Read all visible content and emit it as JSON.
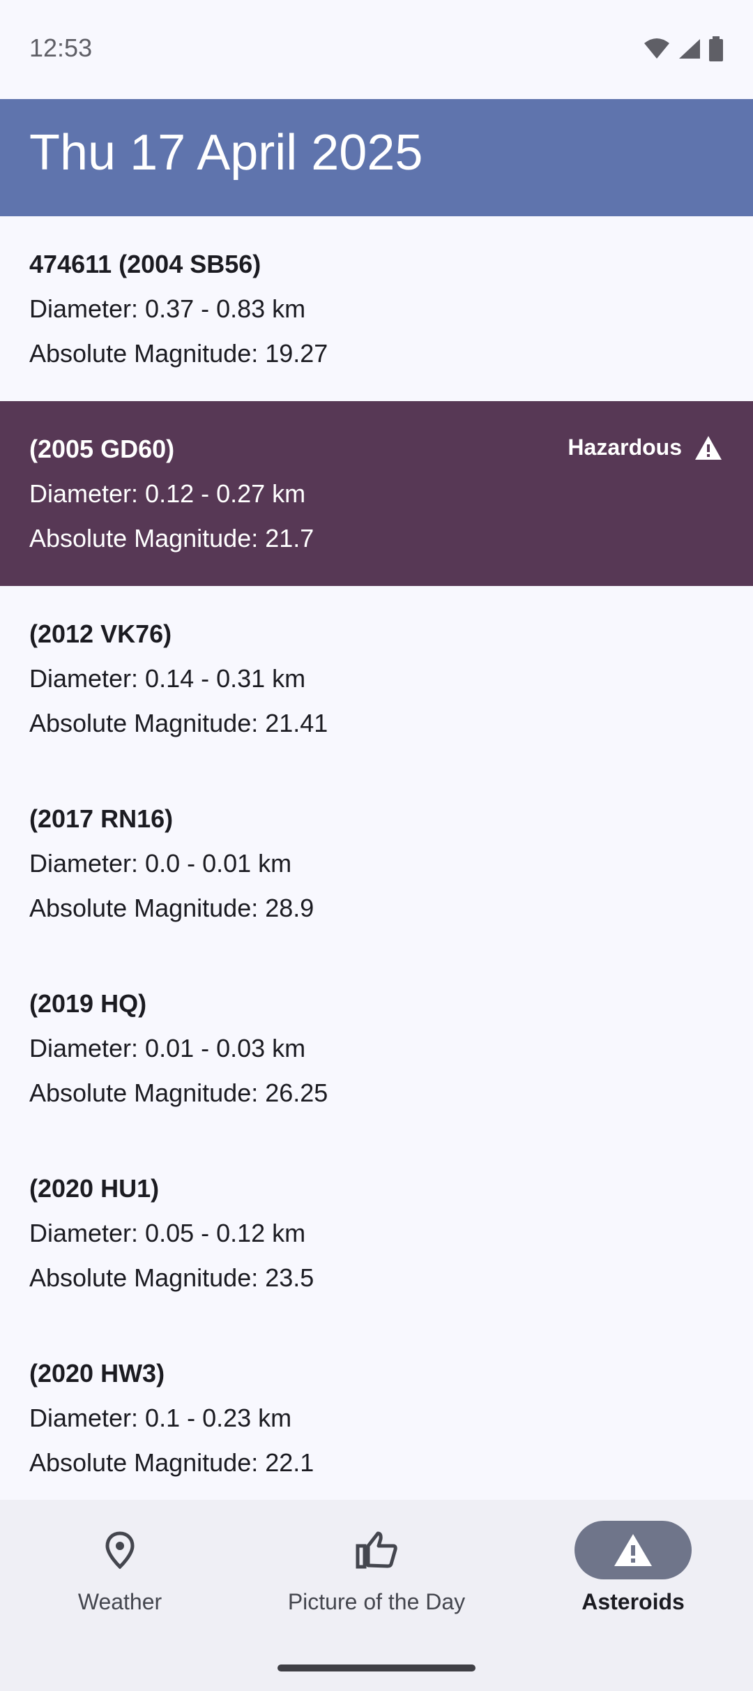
{
  "status_bar": {
    "time": "12:53"
  },
  "app_bar": {
    "title": "Thu 17 April 2025"
  },
  "asteroids": [
    {
      "name": "474611 (2004 SB56)",
      "diameter": "Diameter: 0.37 - 0.83 km",
      "magnitude": "Absolute Magnitude: 19.27",
      "hazardous": false
    },
    {
      "name": "(2005 GD60)",
      "diameter": "Diameter: 0.12 - 0.27 km",
      "magnitude": "Absolute Magnitude: 21.7",
      "hazardous": true,
      "hazard_label": "Hazardous"
    },
    {
      "name": "(2012 VK76)",
      "diameter": "Diameter: 0.14 - 0.31 km",
      "magnitude": "Absolute Magnitude: 21.41",
      "hazardous": false
    },
    {
      "name": "(2017 RN16)",
      "diameter": "Diameter: 0.0 - 0.01 km",
      "magnitude": "Absolute Magnitude: 28.9",
      "hazardous": false
    },
    {
      "name": "(2019 HQ)",
      "diameter": "Diameter: 0.01 - 0.03 km",
      "magnitude": "Absolute Magnitude: 26.25",
      "hazardous": false
    },
    {
      "name": "(2020 HU1)",
      "diameter": "Diameter: 0.05 - 0.12 km",
      "magnitude": "Absolute Magnitude: 23.5",
      "hazardous": false
    },
    {
      "name": "(2020 HW3)",
      "diameter": "Diameter: 0.1 - 0.23 km",
      "magnitude": "Absolute Magnitude: 22.1",
      "hazardous": false
    }
  ],
  "bottom_nav": {
    "items": [
      {
        "label": "Weather",
        "icon": "location-pin-icon",
        "active": false
      },
      {
        "label": "Picture of the Day",
        "icon": "thumbs-up-icon",
        "active": false
      },
      {
        "label": "Asteroids",
        "icon": "warning-icon",
        "active": true
      }
    ]
  },
  "colors": {
    "app_bar": "#5f74ad",
    "hazard_row": "#573855",
    "active_indicator": "#6f758a"
  }
}
